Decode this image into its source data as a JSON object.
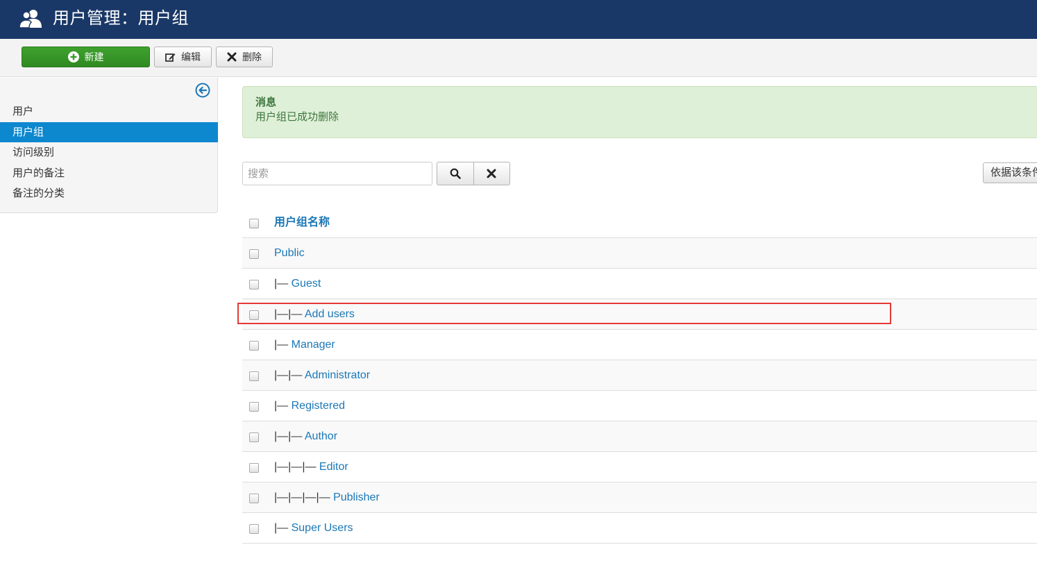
{
  "header": {
    "title": "用户管理：用户组",
    "icon": "users-icon"
  },
  "toolbar": {
    "new_label": "新建",
    "edit_label": "编辑",
    "delete_label": "删除"
  },
  "sidebar": {
    "items": [
      {
        "label": "用户",
        "active": false
      },
      {
        "label": "用户组",
        "active": true
      },
      {
        "label": "访问级别",
        "active": false
      },
      {
        "label": "用户的备注",
        "active": false
      },
      {
        "label": "备注的分类",
        "active": false
      }
    ]
  },
  "alert": {
    "heading": "消息",
    "message": "用户组已成功删除"
  },
  "search": {
    "placeholder": "搜索",
    "filter_label": "依据该条件"
  },
  "table": {
    "header": "用户组名称",
    "rows": [
      {
        "prefix": "",
        "name": "Public"
      },
      {
        "prefix": "|— ",
        "name": "Guest"
      },
      {
        "prefix": "|—|— ",
        "name": "Add users",
        "highlighted": true
      },
      {
        "prefix": "|— ",
        "name": "Manager"
      },
      {
        "prefix": "|—|— ",
        "name": "Administrator"
      },
      {
        "prefix": "|— ",
        "name": "Registered"
      },
      {
        "prefix": "|—|— ",
        "name": "Author"
      },
      {
        "prefix": "|—|—|— ",
        "name": "Editor"
      },
      {
        "prefix": "|—|—|—|— ",
        "name": "Publisher"
      },
      {
        "prefix": "|— ",
        "name": "Super Users"
      }
    ]
  },
  "colors": {
    "header_bg": "#1a3867",
    "accent": "#0d88cf",
    "link": "#1b77b6",
    "new_button": "#3fa12e",
    "alert_bg": "#dff0d8",
    "highlight": "#e53935"
  }
}
